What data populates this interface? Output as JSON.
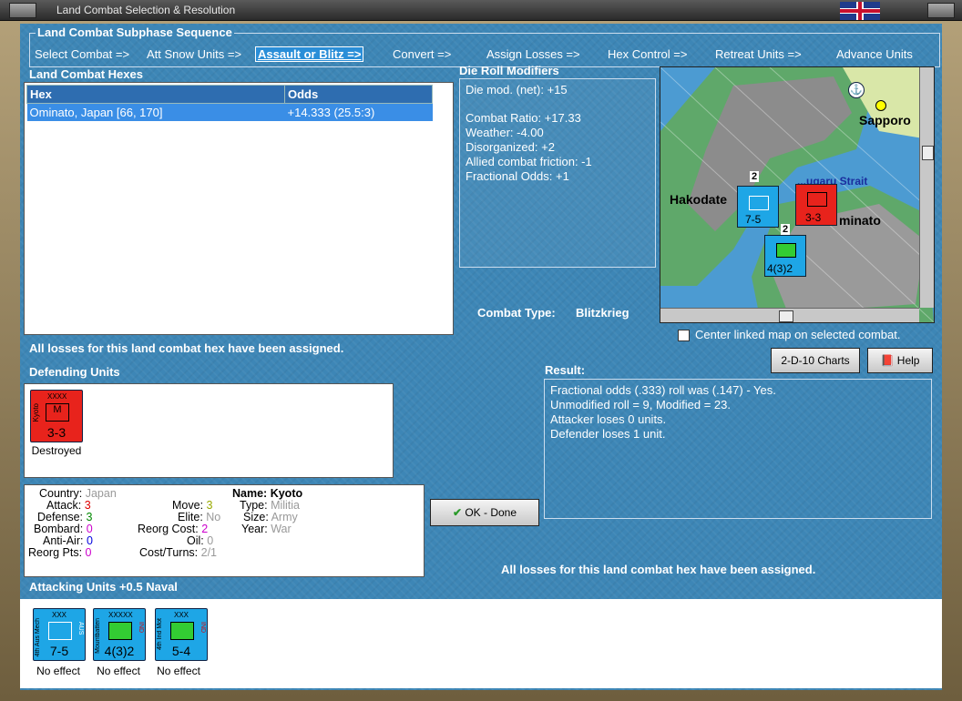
{
  "window": {
    "title": "Land Combat Selection & Resolution"
  },
  "sequence": {
    "legend": "Land Combat Subphase Sequence",
    "steps": [
      "Select Combat =>",
      "Att Snow Units =>",
      "Assault or Blitz =>",
      "Convert =>",
      "Assign Losses =>",
      "Hex Control =>",
      "Retreat Units =>",
      "Advance Units"
    ],
    "active_index": 2
  },
  "hexes": {
    "title": "Land Combat Hexes",
    "columns": [
      "Hex",
      "Odds"
    ],
    "rows": [
      {
        "hex": "Ominato, Japan [66, 170]",
        "odds": "+14.333 (25.5:3)"
      }
    ]
  },
  "die_roll": {
    "title": "Die Roll Modifiers",
    "net": "Die mod. (net): +15",
    "lines": [
      "Combat Ratio: +17.33",
      "Weather: -4.00",
      "Disorganized: +2",
      "Allied combat friction: -1",
      "Fractional Odds: +1"
    ]
  },
  "map": {
    "labels": {
      "sapporo": "Sapporo",
      "hakodate": "Hakodate",
      "strait": "...ugaru Strait",
      "ominato": "minato"
    },
    "stack_a": "2",
    "stack_b": "2",
    "unit_a_value": "7-5",
    "unit_b_value": "4(3)2",
    "unit_c_value": "3-3"
  },
  "combat_type": {
    "label": "Combat Type:",
    "value": "Blitzkrieg"
  },
  "center_map": {
    "label": "Center linked map on selected combat.",
    "checked": false
  },
  "buttons": {
    "charts": "2-D-10 Charts",
    "help": "Help",
    "ok": "OK - Done"
  },
  "losses_msg_top": "All losses for this land combat hex have been assigned.",
  "losses_msg_bottom": "All losses for this land combat hex have been assigned.",
  "defending": {
    "title": "Defending Units",
    "units": [
      {
        "name": "Kyoto",
        "size": "XXXX",
        "type_letter": "M",
        "value": "3-3",
        "status": "Destroyed",
        "color": "#e8231c"
      }
    ]
  },
  "result": {
    "title": "Result:",
    "lines": [
      "Fractional odds (.333) roll was (.147)  - Yes.",
      "Unmodified roll = 9, Modified = 23.",
      "Attacker loses 0 units.",
      "Defender loses 1 unit."
    ]
  },
  "unit_info": {
    "country_label": "Country:",
    "country": "Japan",
    "attack_label": "Attack:",
    "attack": "3",
    "defense_label": "Defense:",
    "defense": "3",
    "bombard_label": "Bombard:",
    "bombard": "0",
    "antiair_label": "Anti-Air:",
    "antiair": "0",
    "reorgpts_label": "Reorg Pts:",
    "reorgpts": "0",
    "move_label": "Move:",
    "move": "3",
    "elite_label": "Elite:",
    "elite": "No",
    "reorgcost_label": "Reorg Cost:",
    "reorgcost": "2",
    "oil_label": "Oil:",
    "oil": "0",
    "costturns_label": "Cost/Turns:",
    "costturns": "2/1",
    "name_label": "Name:",
    "name": "Kyoto",
    "type_label": "Type:",
    "type": "Militia",
    "size_label": "Size:",
    "size": "Army",
    "year_label": "Year:",
    "year": "War"
  },
  "attacking": {
    "title": "Attacking Units +0.5 Naval",
    "units": [
      {
        "name": "4th Aus Mech",
        "size": "XXX",
        "nat": "AUS",
        "value": "7-5",
        "status": "No effect",
        "color": "#1ea6e6"
      },
      {
        "name": "Mountbatten",
        "size": "XXXXX",
        "nat": "IND",
        "value": "4(3)2",
        "status": "No effect",
        "color": "#1ea6e6"
      },
      {
        "name": "4th Ind Mot",
        "size": "XXX",
        "nat": "IND",
        "value": "5-4",
        "status": "No effect",
        "color": "#1ea6e6"
      }
    ]
  }
}
